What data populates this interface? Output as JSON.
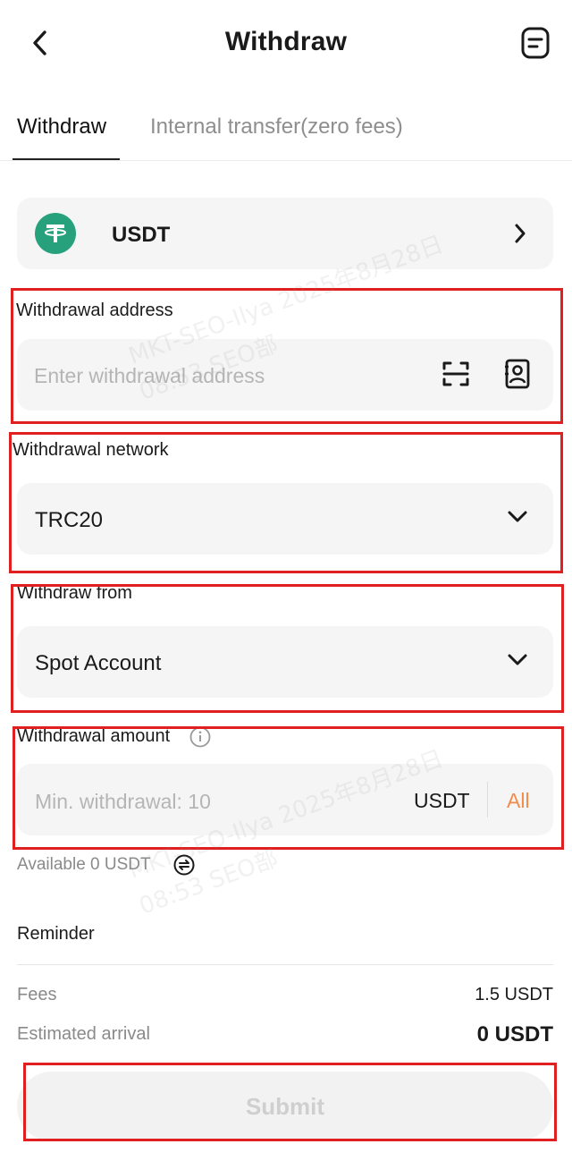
{
  "header": {
    "title": "Withdraw",
    "back_icon": "chevron-left-icon",
    "records_icon": "document-list-icon"
  },
  "tabs": [
    {
      "label": "Withdraw",
      "active": true
    },
    {
      "label": "Internal transfer(zero fees)",
      "active": false
    }
  ],
  "coin": {
    "symbol": "USDT",
    "icon": "tether-logo-icon",
    "brand_color": "#26a17b"
  },
  "address": {
    "label": "Withdrawal address",
    "placeholder": "Enter withdrawal address",
    "scan_icon": "scan-icon",
    "address_book_icon": "address-book-icon"
  },
  "network": {
    "label": "Withdrawal network",
    "value": "TRC20"
  },
  "from": {
    "label": "Withdraw from",
    "value": "Spot Account"
  },
  "amount": {
    "label": "Withdrawal amount",
    "placeholder": "Min. withdrawal: 10",
    "unit": "USDT",
    "all_label": "All",
    "accent_color": "#f28c4a"
  },
  "available": {
    "text": "Available 0 USDT",
    "icon": "transfer-icon"
  },
  "reminder": {
    "label": "Reminder"
  },
  "fees": {
    "label": "Fees",
    "value": "1.5 USDT"
  },
  "arrival": {
    "label": "Estimated arrival",
    "value": "0 USDT"
  },
  "submit": {
    "label": "Submit"
  },
  "watermark": {
    "line1": "MKT-SEO-Ilya 2025年8月28日",
    "line2": "08:53 SEO部"
  },
  "colors": {
    "highlight_border": "#e02020",
    "field_bg": "#f5f5f5"
  }
}
